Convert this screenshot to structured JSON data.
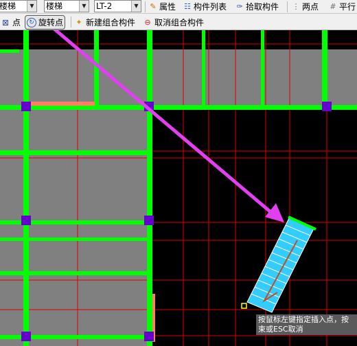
{
  "toolbar_row1": {
    "combo_type": "楼梯",
    "combo_category": "楼梯",
    "combo_name": "LT-2",
    "btn_properties": "属性",
    "btn_component_list": "构件列表",
    "btn_pick_component": "拾取构件",
    "btn_two_points": "两点",
    "btn_parallel": "平行"
  },
  "toolbar_row2": {
    "btn_point": "点",
    "btn_rotate_point": "旋转点",
    "btn_new_group": "新建组合构件",
    "btn_cancel_group": "取消组合构件"
  },
  "tooltip": {
    "line1": "按鼠标左键指定插入点，按",
    "line2": "束或ESC取消"
  },
  "colors": {
    "canvas_bg": "#000000",
    "slab_fill": "#808080",
    "beam_green": "#00ff00",
    "grid_red": "#e00000",
    "column_purple": "#6600cc",
    "arrow_magenta": "#e040f0",
    "stair_cyan": "#33ccff",
    "salmon_edge": "#ff8060"
  },
  "icons": {
    "properties": "properties-icon",
    "component_list": "component-list-icon",
    "pick": "pick-icon",
    "two_points": "two-points-icon",
    "parallel": "parallel-icon",
    "point": "point-icon",
    "rotate_point": "rotate-point-icon",
    "new_group": "new-group-icon",
    "cancel_group": "cancel-group-icon"
  }
}
